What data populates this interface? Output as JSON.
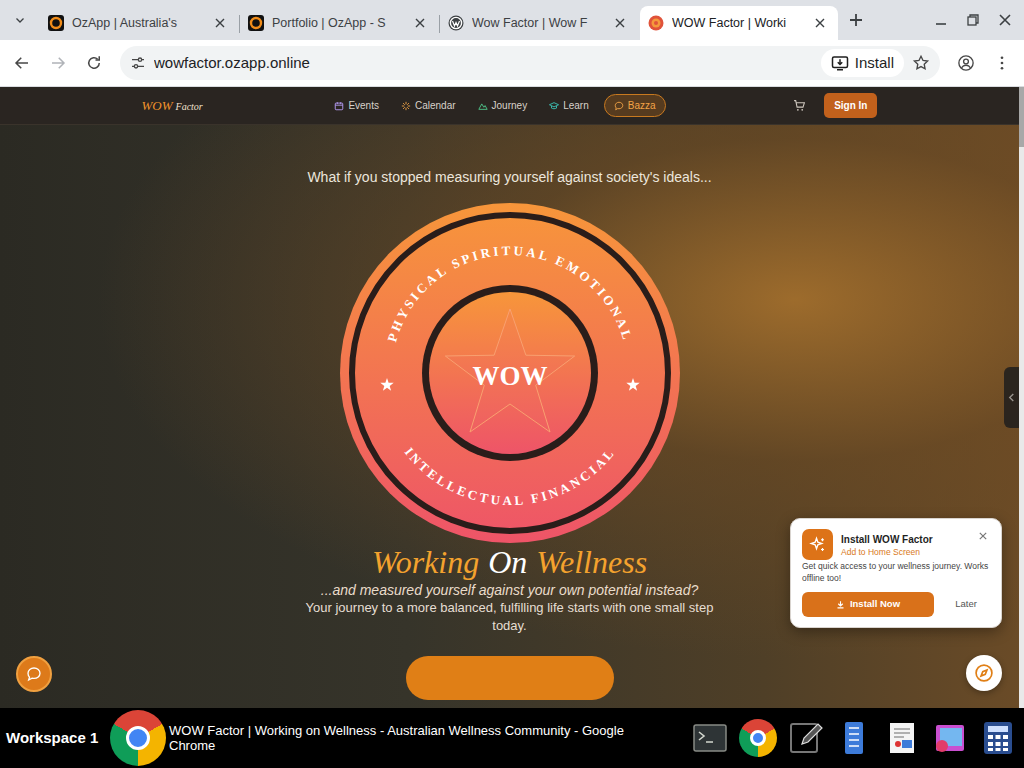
{
  "browser": {
    "tabs": [
      {
        "label": "OzApp | Australia's",
        "kind": "ozapp",
        "selected": false
      },
      {
        "label": "Portfolio | OzApp - S",
        "kind": "ozapp",
        "selected": false
      },
      {
        "label": "Wow Factor | Wow F",
        "kind": "wordpress",
        "selected": false
      },
      {
        "label": "WOW Factor | Worki",
        "kind": "wow",
        "selected": true
      }
    ],
    "address": "wowfactor.ozapp.online",
    "install_chip": "Install"
  },
  "site": {
    "logo": {
      "main": "WOW",
      "sub": "Factor"
    },
    "nav": [
      {
        "label": "Events",
        "kind": "events",
        "highlighted": false
      },
      {
        "label": "Calendar",
        "kind": "calendar",
        "highlighted": false
      },
      {
        "label": "Journey",
        "kind": "journey",
        "highlighted": false
      },
      {
        "label": "Learn",
        "kind": "learn",
        "highlighted": false
      },
      {
        "label": "Bazza",
        "kind": "chat",
        "highlighted": true
      }
    ],
    "sign_in": "Sign In"
  },
  "hero": {
    "kicker": "What if you stopped measuring yourself against society's ideals...",
    "badge": {
      "top": "PHYSICAL SPIRITUAL EMOTIONAL",
      "bottom": "INTELLECTUAL FINANCIAL",
      "center": "WOW"
    },
    "title": [
      {
        "text": "Working",
        "color": "#f4a22e"
      },
      {
        "text": "On",
        "color": "#ffffff"
      },
      {
        "text": "Wellness",
        "color": "#f4a22e"
      }
    ],
    "subtitle": "...and measured yourself against your own potential instead?",
    "body": "Your journey to a more balanced, fulfilling life starts with one small step today."
  },
  "install_prompt": {
    "title": "Install WOW Factor",
    "subtitle": "Add to Home Screen",
    "body": "Get quick access to your wellness journey. Works offline too!",
    "install": "Install Now",
    "later": "Later"
  },
  "taskbar": {
    "workspace": "Workspace 1",
    "window_title": "WOW Factor | Working on Wellness - Australian Wellness Community - Google Chrome"
  }
}
